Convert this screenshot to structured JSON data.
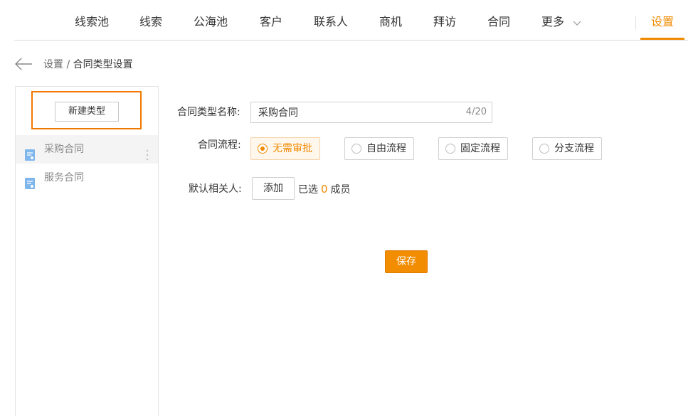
{
  "nav": {
    "items": [
      {
        "label": "线索池"
      },
      {
        "label": "线索"
      },
      {
        "label": "公海池"
      },
      {
        "label": "客户"
      },
      {
        "label": "联系人"
      },
      {
        "label": "商机"
      },
      {
        "label": "拜访"
      },
      {
        "label": "合同"
      },
      {
        "label": "更多"
      }
    ],
    "settings": "设置",
    "accent_color": "#f08a00"
  },
  "breadcrumb": {
    "parent": "设置",
    "separator": "/",
    "current": "合同类型设置"
  },
  "sidebar": {
    "new_type_label": "新建类型",
    "types": [
      {
        "label": "采购合同",
        "active": true,
        "icon": "document-icon"
      },
      {
        "label": "服务合同",
        "active": false,
        "icon": "document-icon"
      }
    ]
  },
  "form": {
    "name_label": "合同类型名称:",
    "name_value": "采购合同",
    "name_count": "4/20",
    "process_label": "合同流程:",
    "process_options": [
      {
        "label": "无需审批",
        "selected": true
      },
      {
        "label": "自由流程",
        "selected": false
      },
      {
        "label": "固定流程",
        "selected": false
      },
      {
        "label": "分支流程",
        "selected": false
      }
    ],
    "related_label": "默认相关人:",
    "add_label": "添加",
    "selected_prefix": "已选",
    "selected_count": "0",
    "selected_suffix": "成员",
    "save_label": "保存"
  }
}
